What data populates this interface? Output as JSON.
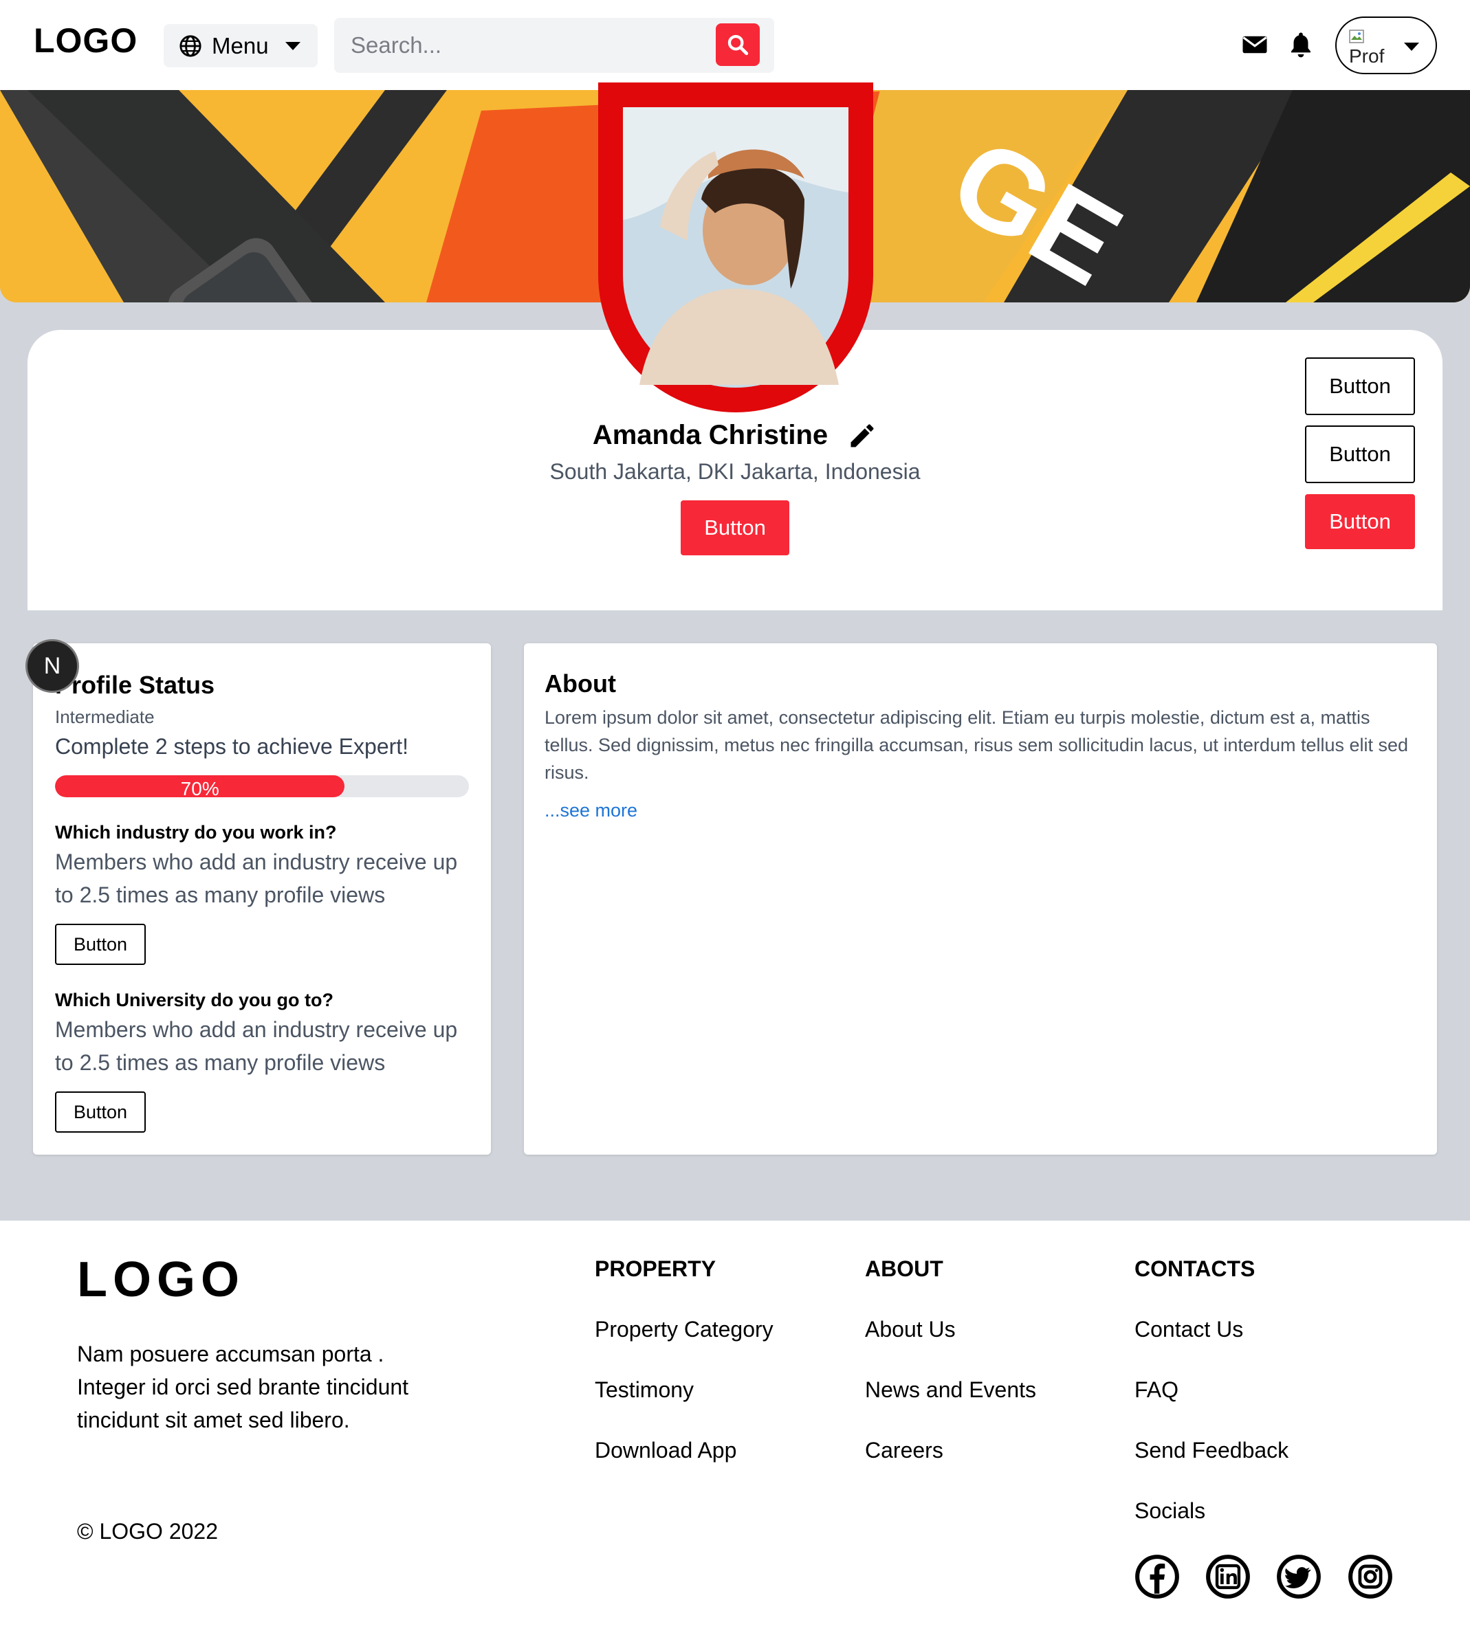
{
  "header": {
    "logo": "LOGO",
    "menu_label": "Menu",
    "search_placeholder": "Search...",
    "profile_alt": "Prof"
  },
  "profile": {
    "name": "Amanda Christine",
    "location": "South Jakarta, DKI Jakarta, Indonesia",
    "primary_button": "Button",
    "side_buttons": [
      "Button",
      "Button",
      "Button"
    ]
  },
  "status": {
    "badge": "N",
    "title": "Profile Status",
    "level": "Intermediate",
    "goal": "Complete 2 steps to achieve Expert!",
    "progress_percent": 70,
    "progress_label": "70%",
    "questions": [
      {
        "question": "Which industry do you work in?",
        "description": "Members who add an industry receive up to 2.5 times as many profile views",
        "button": "Button"
      },
      {
        "question": "Which University do you go to?",
        "description": "Members who add an industry receive up to 2.5 times as many profile views",
        "button": "Button"
      }
    ]
  },
  "about": {
    "title": "About",
    "text": "Lorem ipsum dolor sit amet, consectetur adipiscing elit. Etiam eu turpis molestie, dictum est a, mattis tellus. Sed dignissim, metus nec fringilla accumsan, risus sem sollicitudin lacus, ut interdum tellus elit sed risus.",
    "see_more": "...see more"
  },
  "footer": {
    "logo": "LOGO",
    "description": "Nam posuere accumsan porta . Integer id orci sed brante tincidunt tincidunt sit amet sed libero.",
    "copyright": "© LOGO 2022",
    "columns": [
      {
        "title": "PROPERTY",
        "links": [
          "Property Category",
          "Testimony",
          "Download App"
        ]
      },
      {
        "title": "ABOUT",
        "links": [
          "About Us",
          "News and Events",
          "Careers"
        ]
      },
      {
        "title": "CONTACTS",
        "links": [
          "Contact Us",
          "FAQ",
          "Send Feedback",
          "Socials"
        ]
      }
    ],
    "socials": [
      "facebook-icon",
      "linkedin-icon",
      "twitter-icon",
      "instagram-icon"
    ]
  },
  "colors": {
    "accent": "#f72838",
    "avatar_frame": "#e0080b",
    "page_gray": "#d1d5db",
    "link_blue": "#1e74d6"
  }
}
